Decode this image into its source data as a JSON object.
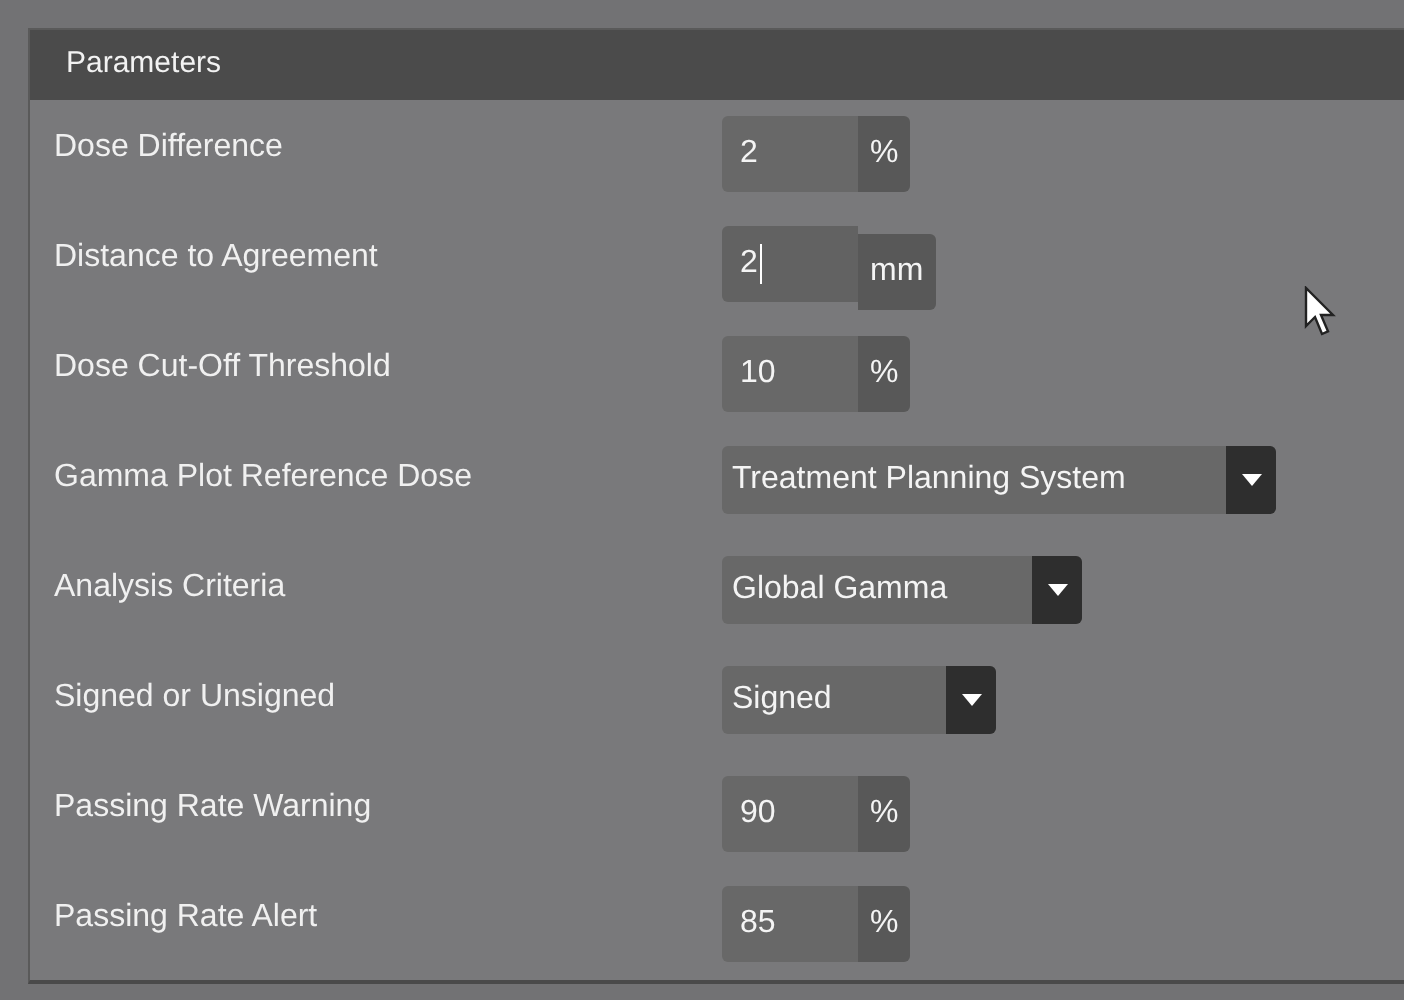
{
  "panel": {
    "title": "Parameters"
  },
  "rows": [
    {
      "label": "Dose Difference",
      "kind": "number",
      "value": "2",
      "unit": "%",
      "focused": false
    },
    {
      "label": "Distance to Agreement",
      "kind": "number",
      "value": "2",
      "unit": "mm",
      "focused": true
    },
    {
      "label": "Dose Cut-Off Threshold",
      "kind": "number",
      "value": "10",
      "unit": "%",
      "focused": false
    },
    {
      "label": "Gamma Plot Reference Dose",
      "kind": "dropdown",
      "value": "Treatment Planning System"
    },
    {
      "label": "Analysis Criteria",
      "kind": "dropdown",
      "value": "Global Gamma"
    },
    {
      "label": "Signed or Unsigned",
      "kind": "dropdown",
      "value": "Signed"
    },
    {
      "label": "Passing Rate Warning",
      "kind": "number",
      "value": "90",
      "unit": "%",
      "focused": false
    },
    {
      "label": "Passing Rate Alert",
      "kind": "number",
      "value": "85",
      "unit": "%",
      "focused": false
    }
  ]
}
